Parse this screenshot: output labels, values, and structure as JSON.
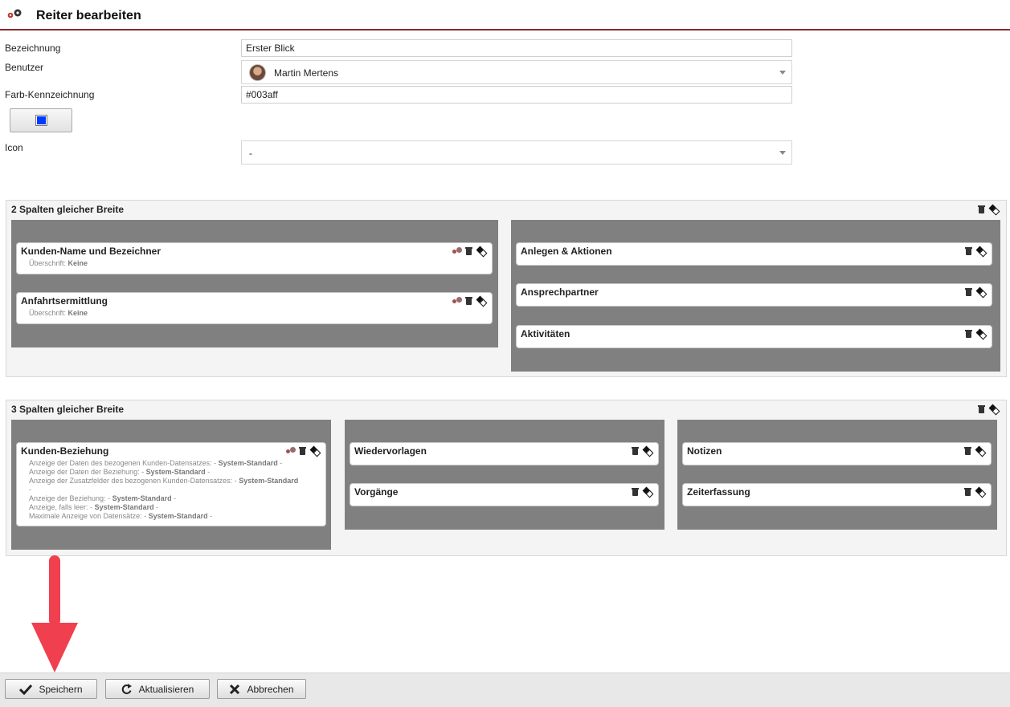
{
  "header": {
    "title": "Reiter bearbeiten",
    "icon": "gears-icon"
  },
  "form": {
    "bezeichnung_label": "Bezeichnung",
    "bezeichnung_value": "Erster Blick",
    "benutzer_label": "Benutzer",
    "benutzer_value": "Martin Mertens",
    "farbe_label": "Farb-Kennzeichnung",
    "farbe_value": "#003aff",
    "icon_label": "Icon",
    "icon_value": "-"
  },
  "sections": [
    {
      "title": "2 Spalten gleicher Breite",
      "columns": [
        {
          "cards": [
            {
              "title": "Kunden-Name und Bezeichner",
              "sub_label": "Überschrift:",
              "sub_value": "Keine"
            },
            {
              "title": "Anfahrtsermittlung",
              "sub_label": "Überschrift:",
              "sub_value": "Keine"
            }
          ]
        },
        {
          "cards": [
            {
              "title": "Anlegen & Aktionen"
            },
            {
              "title": "Ansprechpartner"
            },
            {
              "title": "Aktivitäten"
            }
          ]
        }
      ]
    },
    {
      "title": "3 Spalten gleicher Breite",
      "columns": [
        {
          "cards": [
            {
              "title": "Kunden-Beziehung",
              "lines": [
                {
                  "label": "Anzeige der Daten des bezogenen Kunden-Datensatzes: -",
                  "value": "System-Standard",
                  "tail": "-"
                },
                {
                  "label": "Anzeige der Daten der Beziehung: -",
                  "value": "System-Standard",
                  "tail": "-"
                },
                {
                  "label": "Anzeige der Zusatzfelder des bezogenen Kunden-Datensatzes: -",
                  "value": "System-Standard",
                  "tail": ""
                },
                {
                  "label": "-",
                  "value": "",
                  "tail": ""
                },
                {
                  "label": "Anzeige der Beziehung: -",
                  "value": "System-Standard",
                  "tail": "-"
                },
                {
                  "label": "Anzeige, falls leer: -",
                  "value": "System-Standard",
                  "tail": "-"
                },
                {
                  "label": "Maximale Anzeige von Datensätze: -",
                  "value": "System-Standard",
                  "tail": "-"
                }
              ]
            }
          ]
        },
        {
          "cards": [
            {
              "title": "Wiedervorlagen"
            },
            {
              "title": "Vorgänge"
            }
          ]
        },
        {
          "cards": [
            {
              "title": "Notizen"
            },
            {
              "title": "Zeiterfassung"
            }
          ]
        }
      ]
    }
  ],
  "footer": {
    "save_label": "Speichern",
    "refresh_label": "Aktualisieren",
    "cancel_label": "Abbrechen"
  },
  "colors": {
    "accent_line": "#8b2a2a",
    "swatch": "#003aff",
    "arrow": "#f04050",
    "column_bg": "#808080"
  }
}
